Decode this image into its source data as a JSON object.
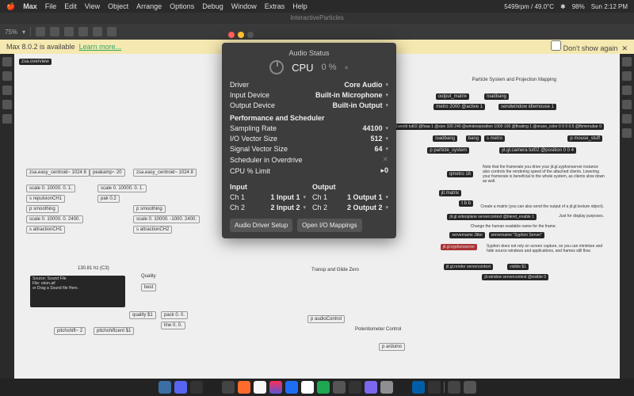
{
  "menubar": {
    "app": "Max",
    "items": [
      "File",
      "Edit",
      "View",
      "Object",
      "Arrange",
      "Options",
      "Debug",
      "Window",
      "Extras",
      "Help"
    ],
    "right": [
      "5499rpm / 49.0°C",
      "✱",
      "98%",
      "Sun 2:12 PM"
    ]
  },
  "window_title": "InteractiveParticles",
  "toolbar": {
    "zoom": "75%"
  },
  "notice": {
    "text": "Max 8.0.2 is available",
    "link": "Learn more...",
    "checkbox": "Don't show again"
  },
  "audio": {
    "title": "Audio Status",
    "cpu_label": "CPU",
    "cpu_pct": "0 %",
    "driver_l": "Driver",
    "driver_v": "Core Audio",
    "in_l": "Input Device",
    "in_v": "Built-in Microphone",
    "out_l": "Output Device",
    "out_v": "Built-in Output",
    "perf": "Performance and Scheduler",
    "sr_l": "Sampling Rate",
    "sr_v": "44100",
    "io_l": "I/O Vector Size",
    "io_v": "512",
    "sv_l": "Signal Vector Size",
    "sv_v": "64",
    "so_l": "Scheduler in Overdrive",
    "so_v": "✕",
    "cl_l": "CPU % Limit",
    "cl_v": "0",
    "input": "Input",
    "output": "Output",
    "ch1": "Ch 1",
    "ch2": "Ch 2",
    "in1": "1 Input 1",
    "in2": "2 Input 2",
    "out1": "1 Output 1",
    "out2": "2 Output 2",
    "btn1": "Audio Driver Setup",
    "btn2": "Open I/O Mappings"
  },
  "patch": {
    "overview": "zsa.overview",
    "sec_right": "Particle System and Projection Mapping",
    "n": [
      "output_matrix",
      "loadbang",
      "metro 2000 @active 1",
      "sendwindow idlemouse 1",
      "jit.world tut02 @fsaa 1 @size 320 240 @windowposition 1000 100 @floating 1 @erase_color 0 0 0 0.5 @fbmenubar 0",
      "loadbang",
      "bang",
      "s metro",
      "p mouse_stuff",
      "p particle_system",
      "jit.gl.camera tut02 @position 0 0 4",
      "qmetro 16",
      "jit.matrix",
      "t b b",
      "Note that the framerate you drive your jit.gl.syphonserver instance also controls the rendering speed of the attached clients. Lowering your framerate is beneficial to the whole system, as clients slow down as well.",
      "Create a matrix (you can also send the output of a jit.gl.texture object).",
      "jit.gl.videoplane servercontext @blend_enable 1",
      "Just for display purposes.",
      "Change the human readable name for the frame.",
      "servername Jitter",
      "servername \"Syphon Server\"",
      "jit.gl.syphonserver",
      "Syphon does not rely on screen capture, so you can minimize and hide source windows and applications, and frames still flow.",
      "jit.gl.render servercontext",
      "visible $1",
      "jit.window servercontext @visible 0",
      "zsa.easy_centroid~ 1024 8",
      "peakamp~ 20",
      "zsa.easy_centroid~ 1024 8",
      "scale 0. 10000. 0. 1.",
      "s repulsionCH1",
      "p smoothing",
      "scale 0. 10000. 0. 2400.",
      "s attractionCH1",
      "scale 0. 10000. 0. 1.",
      "pak 0.2",
      "p smoothing",
      "scale 0. 10000. -1000. 2400.",
      "s attractionCH2",
      "130.81 hz (C3)",
      "Source: Sound File",
      "File: orion.aif",
      "or Drag a Sound file Here.",
      "Quality",
      "best",
      "quality $1",
      "pack 0. 0.",
      "line 0. 0.",
      "pitchshift~ 2",
      "pitchshiftcent $1",
      "Transp and Glide Zero",
      "p audioControl",
      "Potentiometer Control",
      "p arduino"
    ]
  }
}
